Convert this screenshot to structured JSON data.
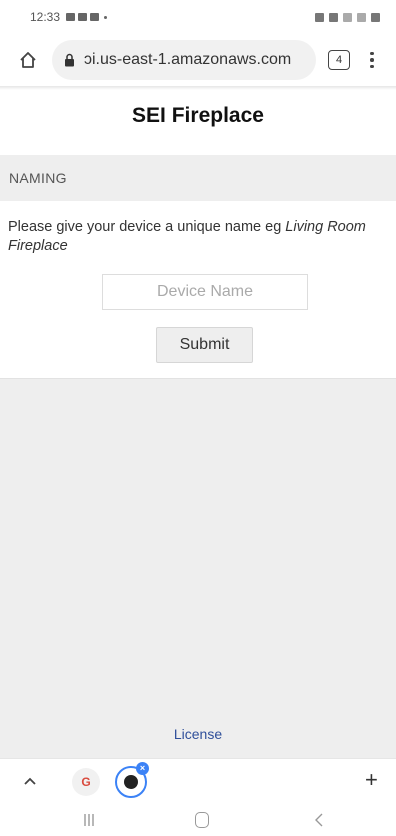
{
  "status_bar": {
    "time": "12:33"
  },
  "browser": {
    "url": "ɔi.us-east-1.amazonaws.com",
    "tab_count": "4"
  },
  "page": {
    "title": "SEI Fireplace",
    "section_header": "NAMING",
    "instructions_prefix": "Please give your device a unique name eg ",
    "instructions_example": "Living Room Fireplace",
    "device_name_placeholder": "Device Name",
    "device_name_value": "",
    "submit_label": "Submit",
    "license_label": "License"
  },
  "bottom_bar": {
    "tabs": [
      {
        "icon": "google-icon",
        "label": "G"
      },
      {
        "icon": "globe-icon"
      }
    ]
  },
  "colors": {
    "link": "#2f4f9a",
    "section_bg": "#eeeeee",
    "active_tab_ring": "#3b82f6"
  }
}
